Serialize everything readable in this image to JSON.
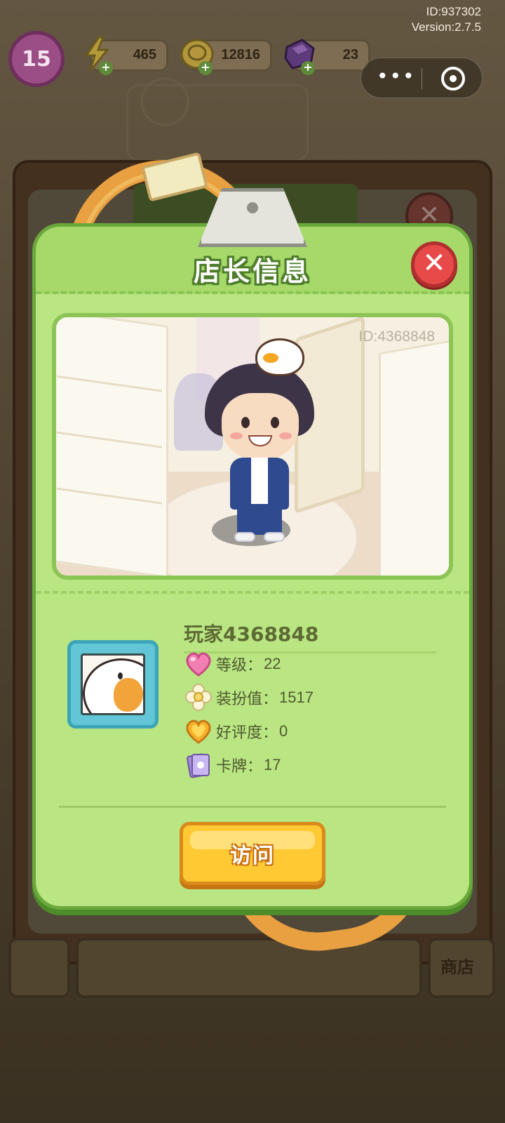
{
  "system": {
    "id_text": "ID:937302",
    "version_text": "Version:2.7.5"
  },
  "hud": {
    "level": "15",
    "energy": "465",
    "coins": "12816",
    "gems": "23"
  },
  "background": {
    "bottom_left_label": "",
    "bottom_right_label": "商店"
  },
  "dialog": {
    "title": "店长信息",
    "preview_id": "ID:4368848",
    "player_name": "玩家4368848",
    "stats": [
      {
        "icon": "pink-heart-icon",
        "label": "等级：",
        "value": "22"
      },
      {
        "icon": "flower-icon",
        "label": "装扮值：",
        "value": "1517"
      },
      {
        "icon": "gold-heart-icon",
        "label": "好评度：",
        "value": "0"
      },
      {
        "icon": "card-icon",
        "label": "卡牌：",
        "value": "17"
      }
    ],
    "visit_label": "访问"
  },
  "colors": {
    "dialog_bg": "#b9e582",
    "dialog_border": "#6aa83c",
    "close_red": "#e84a4a",
    "visit_yellow": "#ffc933",
    "avatar_frame": "#63c6d6"
  }
}
